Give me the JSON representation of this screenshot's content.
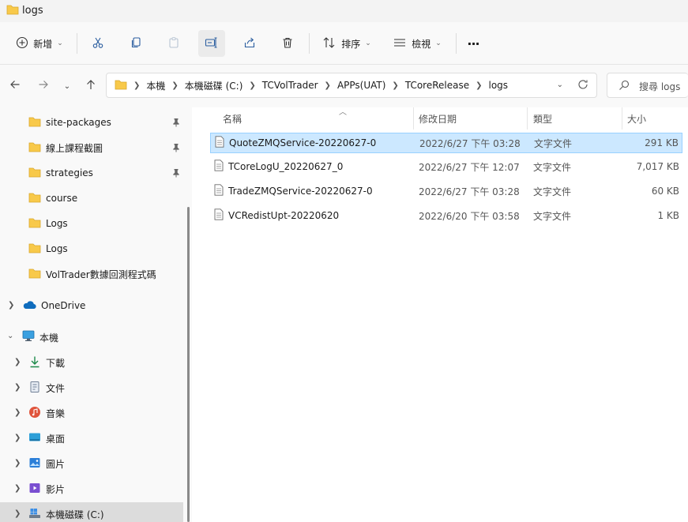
{
  "window": {
    "title": "logs"
  },
  "toolbar": {
    "new_label": "新增",
    "sort_label": "排序",
    "view_label": "檢視",
    "more_label": "···"
  },
  "address": {
    "crumbs": [
      "本機",
      "本機磁碟 (C:)",
      "TCVolTrader",
      "APPs(UAT)",
      "TCoreRelease",
      "logs"
    ]
  },
  "search": {
    "placeholder": "搜尋 logs"
  },
  "sidebar": {
    "pinned": [
      {
        "label": "site-packages",
        "pinned": true
      },
      {
        "label": "線上課程截圖",
        "pinned": true
      },
      {
        "label": "strategies",
        "pinned": true
      },
      {
        "label": "course",
        "pinned": false
      },
      {
        "label": "Logs",
        "pinned": false
      },
      {
        "label": "Logs",
        "pinned": false
      },
      {
        "label": "VolTrader數據回測程式碼",
        "pinned": false
      }
    ],
    "onedrive": "OneDrive",
    "thispc": "本機",
    "pc_children": [
      {
        "label": "下載",
        "icon": "download-icon"
      },
      {
        "label": "文件",
        "icon": "documents-icon"
      },
      {
        "label": "音樂",
        "icon": "music-icon"
      },
      {
        "label": "桌面",
        "icon": "desktop-icon"
      },
      {
        "label": "圖片",
        "icon": "pictures-icon"
      },
      {
        "label": "影片",
        "icon": "videos-icon"
      },
      {
        "label": "本機磁碟 (C:)",
        "icon": "drive-icon"
      }
    ]
  },
  "columns": {
    "name": "名稱",
    "date": "修改日期",
    "type": "類型",
    "size": "大小"
  },
  "files": [
    {
      "name": "QuoteZMQService-20220627-0",
      "date": "2022/6/27 下午 03:28",
      "type": "文字文件",
      "size": "291 KB"
    },
    {
      "name": "TCoreLogU_20220627_0",
      "date": "2022/6/27 下午 12:07",
      "type": "文字文件",
      "size": "7,017 KB"
    },
    {
      "name": "TradeZMQService-20220627-0",
      "date": "2022/6/27 下午 03:28",
      "type": "文字文件",
      "size": "60 KB"
    },
    {
      "name": "VCRedistUpt-20220620",
      "date": "2022/6/20 下午 03:58",
      "type": "文字文件",
      "size": "1 KB"
    }
  ],
  "colors": {
    "folder": "#f8c94a",
    "selection": "#cce8ff",
    "accent": "#0067c0"
  }
}
